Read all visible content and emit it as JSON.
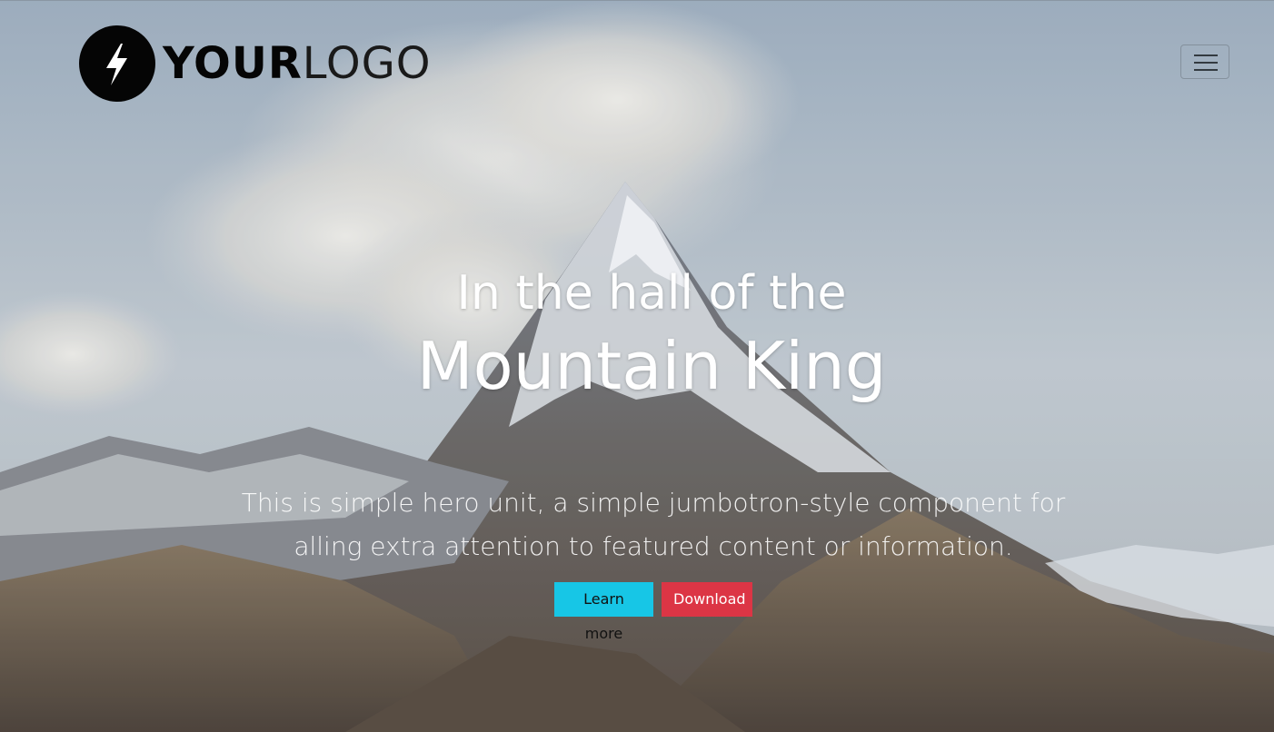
{
  "brand": {
    "logo_bold": "YOUR",
    "logo_light": "LOGO",
    "icon": "lightning-bolt-icon"
  },
  "nav": {
    "toggle_icon": "hamburger-menu-icon"
  },
  "hero": {
    "heading_small": "In the hall of the",
    "heading_large": "Mountain King",
    "lead_line1": "This is simple hero unit, a simple jumbotron-style component for",
    "lead_line2": "alling extra attention to featured content or information.",
    "buttons": {
      "learn_more": "Learn more",
      "download": "Download"
    }
  },
  "colors": {
    "info": "#17c6e6",
    "danger": "#dc3545",
    "logo": "#050505"
  }
}
